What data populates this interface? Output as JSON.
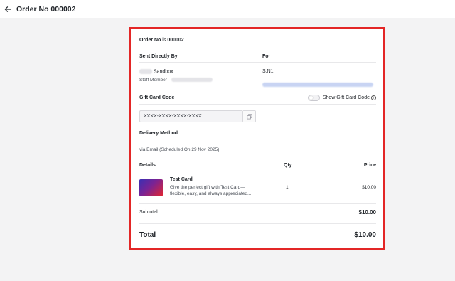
{
  "header": {
    "title": "Order No 000002"
  },
  "order": {
    "label": "Order No",
    "is_word": "is",
    "number": "000002"
  },
  "sender": {
    "heading": "Sent Directly By",
    "name": "Sandbox",
    "staff_label": "Staff Member -"
  },
  "recipient": {
    "heading": "For",
    "name": "S.N1"
  },
  "gift_code": {
    "heading": "Gift Card Code",
    "toggle_label": "Show Gift Card Code",
    "masked_value": "XXXX-XXXX-XXXX-XXXX"
  },
  "delivery": {
    "heading": "Delivery Method",
    "text": "via Email (Scheduled On 29 Nov 2025)"
  },
  "items_table": {
    "columns": [
      "Details",
      "Qty",
      "Price"
    ],
    "rows": [
      {
        "name": "Test Card",
        "description_line1": "Give the perfect gift with Test Card—",
        "description_line2": "flexible, easy, and always appreciated...",
        "qty": "1",
        "price": "$10.00"
      }
    ]
  },
  "summary": {
    "subtotal_label": "Subtotal",
    "subtotal_value": "$10.00",
    "total_label": "Total",
    "total_value": "$10.00"
  },
  "colors": {
    "highlight_border": "#e32626",
    "link": "#4a6fe3"
  },
  "icons": {
    "back": "arrow-left-icon",
    "copy": "copy-icon",
    "info": "info-icon"
  }
}
